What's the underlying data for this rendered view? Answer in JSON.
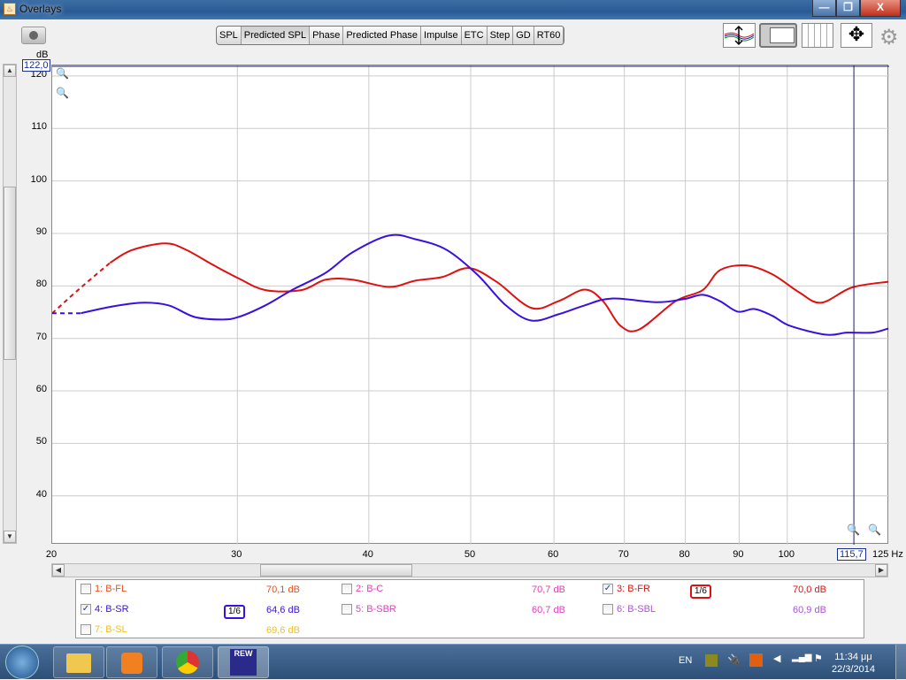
{
  "window": {
    "title": "Overlays",
    "min": "—",
    "max": "❐",
    "close": "X"
  },
  "tabs": [
    {
      "label": "SPL"
    },
    {
      "label": "Predicted SPL",
      "selected": true
    },
    {
      "label": "Phase"
    },
    {
      "label": "Predicted Phase"
    },
    {
      "label": "Impulse"
    },
    {
      "label": "ETC"
    },
    {
      "label": "Step"
    },
    {
      "label": "GD"
    },
    {
      "label": "RT60"
    }
  ],
  "cursor": {
    "y_readout": "122,0",
    "x_readout": "115,7"
  },
  "chart_data": {
    "type": "line",
    "ylabel": "dB",
    "xlabel": "Hz",
    "xscale": "log",
    "xlim": [
      20,
      125
    ],
    "ylim": [
      30.7,
      122
    ],
    "yticks": [
      120,
      110,
      100,
      90,
      80,
      70,
      60,
      50,
      40
    ],
    "xticks": [
      20,
      30,
      40,
      50,
      60,
      70,
      80,
      90,
      100
    ],
    "xticklabels": [
      "20",
      "30",
      "40",
      "50",
      "60",
      "70",
      "80",
      "90",
      "100"
    ],
    "x_end_label": "125 Hz",
    "grid": true,
    "series": [
      {
        "name": "3: B-FR",
        "color": "#e01010",
        "extrapolated_below": 21.5,
        "x": [
          20,
          21.3,
          22.7,
          23.8,
          25.6,
          26.8,
          28.5,
          30.1,
          31.9,
          34.5,
          36.4,
          38.6,
          41.8,
          44.3,
          47.0,
          49.8,
          52.9,
          57.1,
          60.6,
          64.2,
          66.8,
          69.4,
          72.3,
          78.3,
          83.1,
          86.3,
          91.4,
          96.8,
          102.6,
          107.7,
          115.2,
          124.8
        ],
        "y": [
          74.8,
          79.7,
          84.4,
          86.8,
          88.1,
          86.9,
          83.9,
          81.4,
          79.2,
          79.2,
          81.2,
          81.2,
          79.8,
          81.0,
          81.7,
          83.4,
          80.8,
          75.8,
          77.1,
          79.3,
          77.1,
          72.4,
          71.7,
          77.1,
          79.2,
          83.0,
          83.9,
          82.2,
          78.8,
          76.8,
          79.7,
          80.8
        ]
      },
      {
        "name": "4: B-SR",
        "color": "#3a10e0",
        "extrapolated_below": 21.3,
        "x": [
          20,
          21.3,
          22.7,
          24.3,
          25.8,
          27.3,
          29.0,
          30.1,
          31.9,
          33.8,
          36.4,
          38.6,
          41.8,
          44.3,
          47.4,
          50.7,
          54.0,
          57.1,
          60.6,
          64.2,
          68.1,
          75.2,
          79.8,
          83.1,
          86.3,
          89.7,
          93.1,
          96.8,
          100.6,
          108.9,
          114,
          120.5,
          124.8
        ],
        "y": [
          74.8,
          74.8,
          76.0,
          76.8,
          76.3,
          74.1,
          73.6,
          74.1,
          76.3,
          79.2,
          82.5,
          86.4,
          89.6,
          88.9,
          86.9,
          82.2,
          76.3,
          73.4,
          74.6,
          76.3,
          77.6,
          76.9,
          77.5,
          78.3,
          77.1,
          75.1,
          75.6,
          74.3,
          72.4,
          70.7,
          71.1,
          71.1,
          71.9
        ]
      }
    ]
  },
  "legend": [
    {
      "label": "1: B-FL",
      "checked": false,
      "value": "70,1 dB",
      "color": "#e05020"
    },
    {
      "label": "2: B-C",
      "checked": false,
      "value": "70,7 dB",
      "color": "#e040b0"
    },
    {
      "label": "3: B-FR",
      "checked": true,
      "value": "70,0 dB",
      "color": "#e01010",
      "smoothing": "1/6"
    },
    {
      "label": "4: B-SR",
      "checked": true,
      "value": "64,6 dB",
      "color": "#3a10e0",
      "smoothing": "1/6"
    },
    {
      "label": "5: B-SBR",
      "checked": false,
      "value": "60,7 dB",
      "color": "#e040c0"
    },
    {
      "label": "6: B-SBL",
      "checked": false,
      "value": "60,9 dB",
      "color": "#b050e0"
    },
    {
      "label": "7: B-SL",
      "checked": false,
      "value": "69,6 dB",
      "color": "#f0c020"
    }
  ],
  "taskbar": {
    "lang": "EN",
    "time": "11:34 μμ",
    "date": "22/3/2014",
    "rew": "REW"
  }
}
